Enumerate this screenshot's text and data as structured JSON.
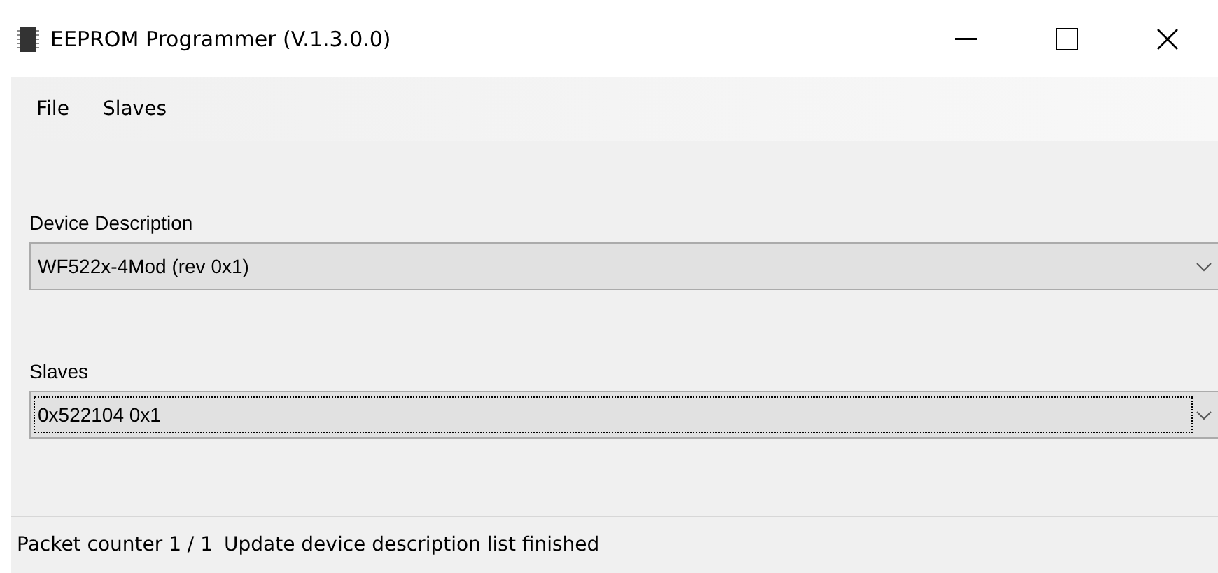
{
  "window": {
    "title": "EEPROM Programmer (V.1.3.0.0)"
  },
  "menu": [
    "File",
    "Slaves"
  ],
  "fields": [
    {
      "label": "Device Description",
      "value": "WF522x-4Mod (rev 0x1)",
      "focused": false
    },
    {
      "label": "Slaves",
      "value": "0x522104 0x1",
      "focused": true
    }
  ],
  "status_bar": {
    "counter": "Packet counter 1 / 1",
    "message": "Update device description list finished"
  }
}
